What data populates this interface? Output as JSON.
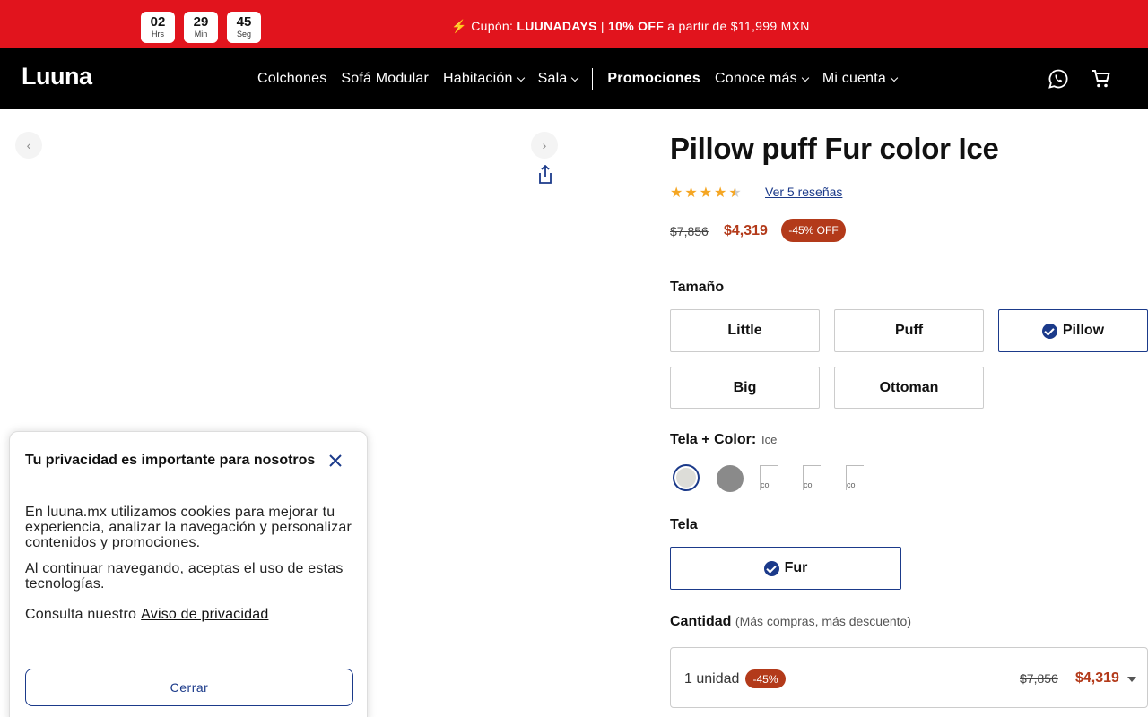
{
  "promo_bar": {
    "timer": [
      {
        "value": "02",
        "unit": "Hrs"
      },
      {
        "value": "29",
        "unit": "Min"
      },
      {
        "value": "45",
        "unit": "Seg"
      }
    ],
    "prefix": "⚡ Cupón: ",
    "code": "LUUNADAYS",
    "sep": " | ",
    "discount": "10% OFF",
    "suffix": " a partir de $11,999 MXN"
  },
  "nav": {
    "logo": "Luuna",
    "items": [
      {
        "label": "Colchones",
        "dropdown": false
      },
      {
        "label": "Sofá Modular",
        "dropdown": false
      },
      {
        "label": "Habitación",
        "dropdown": true
      },
      {
        "label": "Sala",
        "dropdown": true
      },
      {
        "label": "Promociones",
        "dropdown": false
      },
      {
        "label": "Conoce más",
        "dropdown": true
      },
      {
        "label": "Mi cuenta",
        "dropdown": true
      }
    ],
    "icons": [
      "whatsapp-icon",
      "cart-icon"
    ]
  },
  "product": {
    "title": "Pillow puff Fur color Ice",
    "rating": 4.5,
    "reviews_link": "Ver 5 reseñas",
    "old_price": "$7,856",
    "price": "$4,319",
    "discount_badge": "-45% OFF"
  },
  "size": {
    "label": "Tamaño",
    "options": [
      "Little",
      "Puff",
      "Pillow",
      "Big",
      "Ottoman"
    ],
    "selected": "Pillow"
  },
  "color": {
    "label": "Tela + Color:",
    "value": "Ice",
    "swatch_alt": "co",
    "swatches": [
      {
        "name": "Ice",
        "color": "#ddddd8",
        "selected": true
      },
      {
        "name": "Gray",
        "color": "#8a8a8a",
        "selected": false
      }
    ]
  },
  "fabric": {
    "label": "Tela",
    "selected": "Fur"
  },
  "quantity": {
    "label": "Cantidad",
    "sublabel": "(Más compras, más descuento)",
    "unit": "1 unidad",
    "badge": "-45%",
    "old_price": "$7,856",
    "price": "$4,319"
  },
  "cookie": {
    "title": "Tu privacidad es importante para nosotros",
    "p1": "En luuna.mx utilizamos cookies para mejorar tu experiencia, analizar la navegación y personalizar contenidos y promociones.",
    "p2": "Al continuar navegando, aceptas el uso de estas tecnologías.",
    "p3": "Consulta nuestro",
    "link": "Aviso de privacidad",
    "button": "Cerrar"
  },
  "colors": {
    "promo_red": "#e1141d",
    "nav_black": "#000000",
    "accent_blue": "#1b3a8a",
    "price_red": "#b33a1a",
    "star": "#f5a623"
  }
}
